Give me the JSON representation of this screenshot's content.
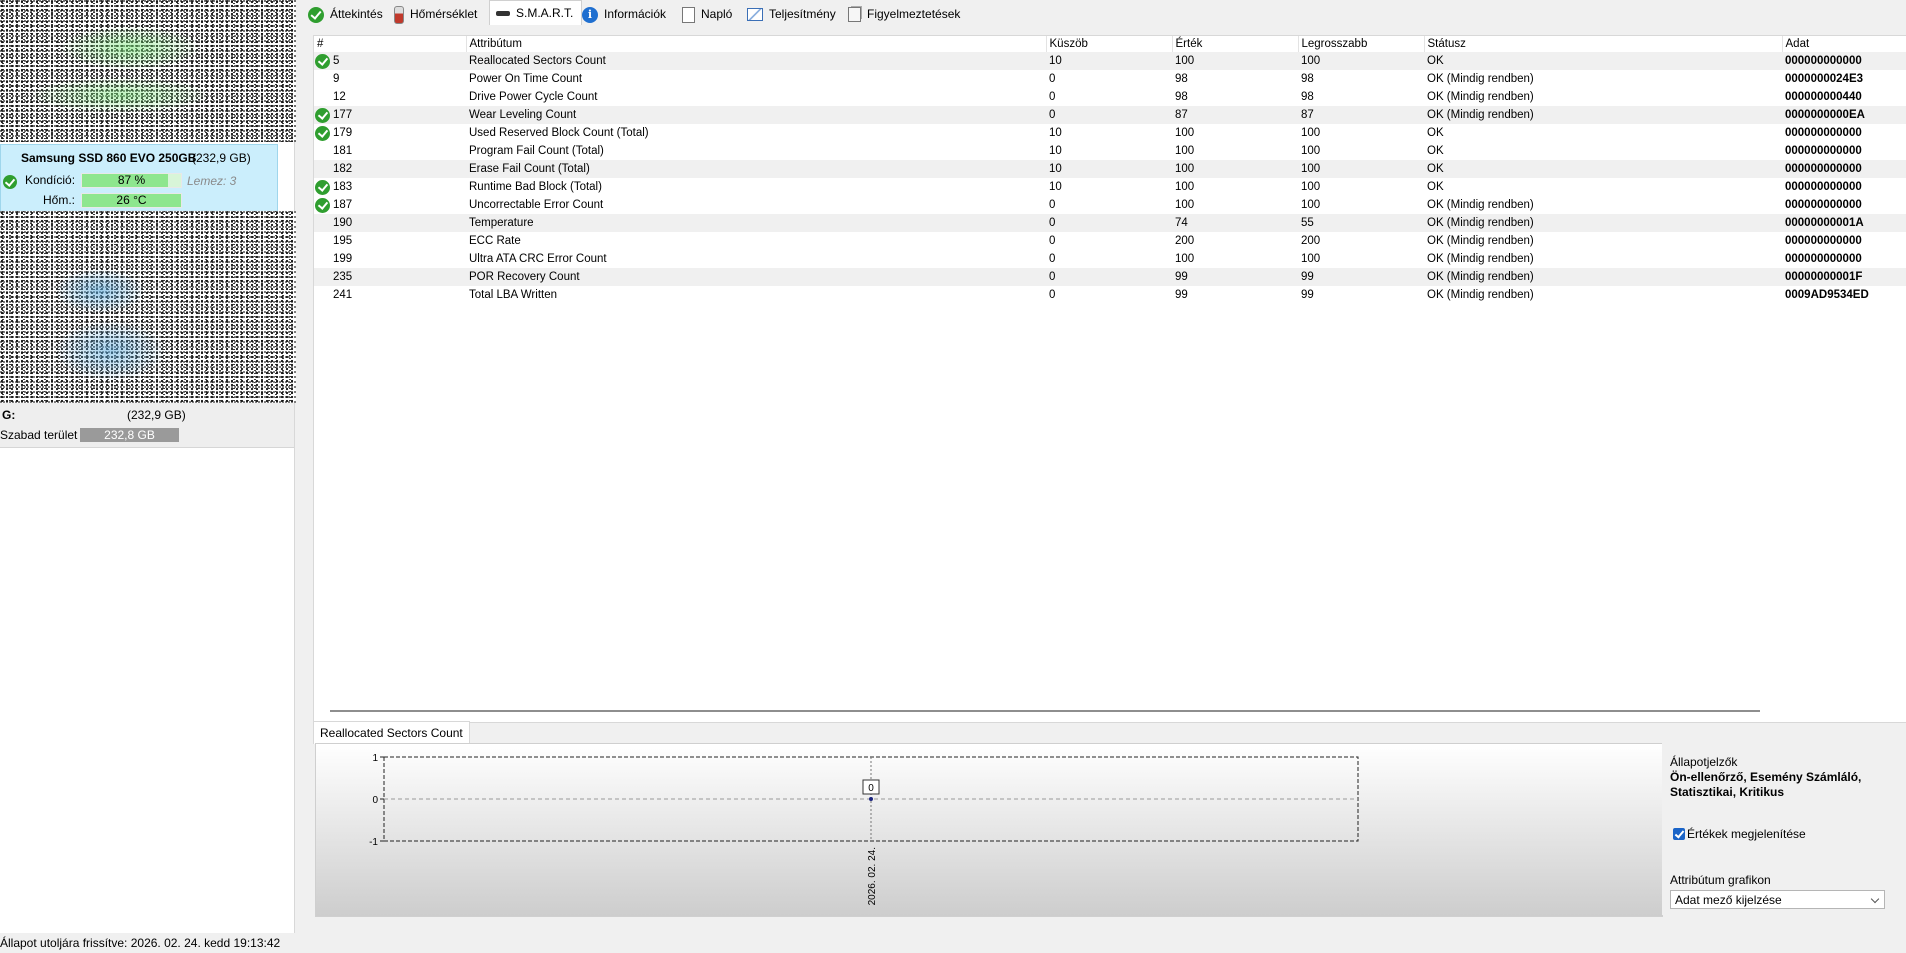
{
  "left_panel": {
    "disk": {
      "name": "Samsung SSD 860 EVO 250GB",
      "size": "(232,9 GB)",
      "condition_label": "Kondíció:",
      "condition_value": "87 %",
      "condition_fraction": 0.87,
      "temp_label": "Hőm.:",
      "temp_value": "26 °C",
      "disk_index": "Lemez: 3"
    },
    "partition": {
      "letter": "G:",
      "size": "(232,9 GB)",
      "free_label": "Szabad terület",
      "free_value": "232,8 GB"
    }
  },
  "tabs": [
    {
      "label": "Áttekintés",
      "icon": "ok-icon"
    },
    {
      "label": "Hőmérséklet",
      "icon": "thermometer-icon"
    },
    {
      "label": "S.M.A.R.T.",
      "icon": "smart-icon"
    },
    {
      "label": "Információk",
      "icon": "info-icon"
    },
    {
      "label": "Napló",
      "icon": "document-icon"
    },
    {
      "label": "Teljesítmény",
      "icon": "performance-icon"
    },
    {
      "label": "Figyelmeztetések",
      "icon": "alerts-icon"
    }
  ],
  "active_tab": "S.M.A.R.T.",
  "table": {
    "columns": [
      "#",
      "Attribútum",
      "Küszöb",
      "Érték",
      "Legrosszabb",
      "Státusz",
      "Adat"
    ],
    "rows": [
      {
        "id": "5",
        "name": "Reallocated Sectors Count",
        "threshold": "10",
        "value": "100",
        "worst": "100",
        "status": "OK",
        "data": "000000000000",
        "check": true
      },
      {
        "id": "9",
        "name": "Power On Time Count",
        "threshold": "0",
        "value": "98",
        "worst": "98",
        "status": "OK (Mindig rendben)",
        "data": "0000000024E3",
        "check": false
      },
      {
        "id": "12",
        "name": "Drive Power Cycle Count",
        "threshold": "0",
        "value": "98",
        "worst": "98",
        "status": "OK (Mindig rendben)",
        "data": "000000000440",
        "check": false
      },
      {
        "id": "177",
        "name": "Wear Leveling Count",
        "threshold": "0",
        "value": "87",
        "worst": "87",
        "status": "OK (Mindig rendben)",
        "data": "0000000000EA",
        "check": true
      },
      {
        "id": "179",
        "name": "Used Reserved Block Count (Total)",
        "threshold": "10",
        "value": "100",
        "worst": "100",
        "status": "OK",
        "data": "000000000000",
        "check": true
      },
      {
        "id": "181",
        "name": "Program Fail Count (Total)",
        "threshold": "10",
        "value": "100",
        "worst": "100",
        "status": "OK",
        "data": "000000000000",
        "check": false
      },
      {
        "id": "182",
        "name": "Erase Fail Count (Total)",
        "threshold": "10",
        "value": "100",
        "worst": "100",
        "status": "OK",
        "data": "000000000000",
        "check": false
      },
      {
        "id": "183",
        "name": "Runtime Bad Block (Total)",
        "threshold": "10",
        "value": "100",
        "worst": "100",
        "status": "OK",
        "data": "000000000000",
        "check": true
      },
      {
        "id": "187",
        "name": "Uncorrectable Error Count",
        "threshold": "0",
        "value": "100",
        "worst": "100",
        "status": "OK (Mindig rendben)",
        "data": "000000000000",
        "check": true
      },
      {
        "id": "190",
        "name": "Temperature",
        "threshold": "0",
        "value": "74",
        "worst": "55",
        "status": "OK (Mindig rendben)",
        "data": "00000000001A",
        "check": false
      },
      {
        "id": "195",
        "name": "ECC Rate",
        "threshold": "0",
        "value": "200",
        "worst": "200",
        "status": "OK (Mindig rendben)",
        "data": "000000000000",
        "check": false
      },
      {
        "id": "199",
        "name": "Ultra ATA CRC Error Count",
        "threshold": "0",
        "value": "100",
        "worst": "100",
        "status": "OK (Mindig rendben)",
        "data": "000000000000",
        "check": false
      },
      {
        "id": "235",
        "name": "POR Recovery Count",
        "threshold": "0",
        "value": "99",
        "worst": "99",
        "status": "OK (Mindig rendben)",
        "data": "00000000001F",
        "check": false
      },
      {
        "id": "241",
        "name": "Total LBA Written",
        "threshold": "0",
        "value": "99",
        "worst": "99",
        "status": "OK (Mindig rendben)",
        "data": "0009AD9534ED",
        "check": false
      }
    ]
  },
  "chart_tab": "Reallocated Sectors Count",
  "chart_data": {
    "type": "line",
    "x": [
      "2026. 02. 24."
    ],
    "values": [
      0
    ],
    "data_labels": [
      "0"
    ],
    "yticks": [
      "1",
      "0",
      "-1"
    ],
    "ylim": [
      -1,
      1
    ],
    "grid": true
  },
  "side": {
    "legend_title": "Állapotjelzők",
    "legend_body": "Ön-ellenőrző, Esemény Számláló, Statisztikai, Kritikus",
    "show_values_label": "Értékek megjelenítése",
    "show_values_checked": true,
    "graph_label": "Attribútum grafikon",
    "graph_select_value": "Adat mező kijelzése"
  },
  "status_bar": "Állapot utoljára frissítve: 2026. 02. 24. kedd 19:13:42"
}
